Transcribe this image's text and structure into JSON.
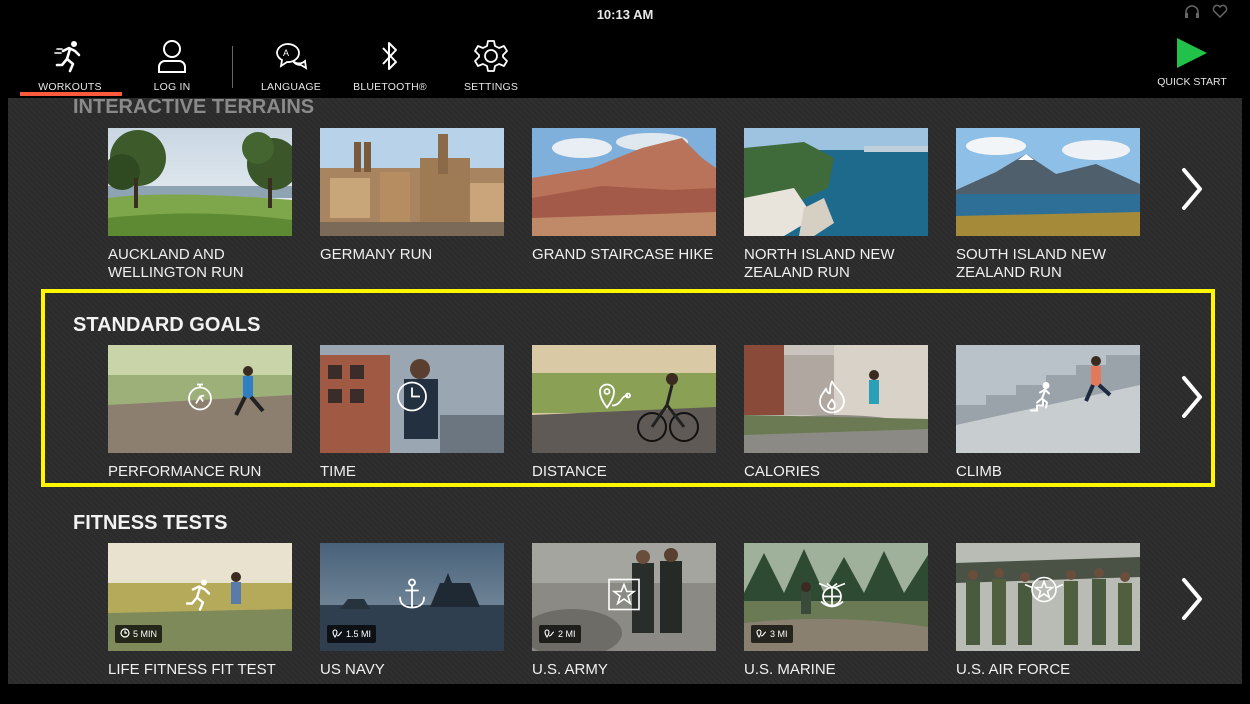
{
  "status": {
    "time": "10:13 AM"
  },
  "nav": [
    {
      "label": "WORKOUTS",
      "icon": "runner-icon"
    },
    {
      "label": "LOG IN",
      "icon": "user-icon"
    },
    {
      "label": "LANGUAGE",
      "icon": "language-bubble-icon"
    },
    {
      "label": "BLUETOOTH®",
      "icon": "bluetooth-icon"
    },
    {
      "label": "SETTINGS",
      "icon": "gear-icon"
    }
  ],
  "quick_start": {
    "label": "QUICK START",
    "icon": "play-icon",
    "color": "#22c24a"
  },
  "accent_color": "#ff5a3c",
  "highlight_color": "#fff700",
  "sections": {
    "terrains": {
      "title": "INTERACTIVE TERRAINS",
      "items": [
        {
          "label": "AUCKLAND AND WELLINGTON RUN"
        },
        {
          "label": "GERMANY RUN"
        },
        {
          "label": "GRAND STAIRCASE HIKE"
        },
        {
          "label": "NORTH ISLAND NEW ZEALAND RUN"
        },
        {
          "label": "SOUTH ISLAND NEW ZEALAND RUN"
        }
      ]
    },
    "goals": {
      "title": "STANDARD GOALS",
      "items": [
        {
          "label": "PERFORMANCE RUN",
          "icon": "stopwatch-runner-icon"
        },
        {
          "label": "TIME",
          "icon": "clock-icon"
        },
        {
          "label": "DISTANCE",
          "icon": "route-pin-icon"
        },
        {
          "label": "CALORIES",
          "icon": "flame-icon"
        },
        {
          "label": "CLIMB",
          "icon": "stair-climber-icon"
        }
      ]
    },
    "tests": {
      "title": "FITNESS TESTS",
      "items": [
        {
          "label": "LIFE FITNESS FIT TEST",
          "badge": "5 MIN",
          "icon": "runner-icon"
        },
        {
          "label": "US NAVY",
          "badge": "1.5 MI",
          "icon": "anchor-icon"
        },
        {
          "label": "U.S. ARMY",
          "badge": "2 MI",
          "icon": "star-icon"
        },
        {
          "label": "U.S. MARINE",
          "badge": "3 MI",
          "icon": "eagle-globe-anchor-icon"
        },
        {
          "label": "U.S. AIR FORCE",
          "icon": "star-wings-icon"
        }
      ]
    }
  }
}
